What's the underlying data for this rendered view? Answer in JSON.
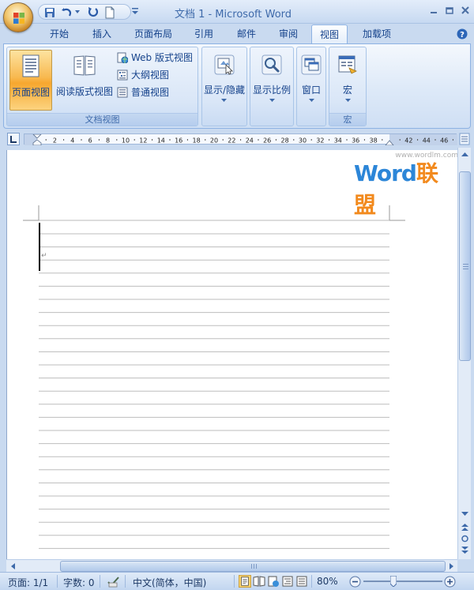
{
  "window": {
    "title": "文档 1 - Microsoft Word"
  },
  "qat": {
    "icons": [
      "save-icon",
      "undo-icon",
      "redo-icon",
      "new-document-icon",
      "customize-qat-icon"
    ]
  },
  "tabs": [
    {
      "label": "开始"
    },
    {
      "label": "插入"
    },
    {
      "label": "页面布局"
    },
    {
      "label": "引用"
    },
    {
      "label": "邮件"
    },
    {
      "label": "审阅"
    },
    {
      "label": "视图",
      "active": true
    },
    {
      "label": "加载项"
    }
  ],
  "ribbon": {
    "doc_views": {
      "group_label": "文档视图",
      "print_layout": "页面视图",
      "full_screen_reading": "阅读版式视图",
      "web_layout": "Web 版式视图",
      "outline": "大纲视图",
      "draft": "普通视图"
    },
    "show_hide": {
      "label": "显示/隐藏"
    },
    "zoom": {
      "label": "显示比例"
    },
    "window": {
      "label": "窗口"
    },
    "macros": {
      "label": "宏",
      "group_label": "宏"
    }
  },
  "ruler": {
    "ticks": [
      "2",
      "4",
      "6",
      "8",
      "10",
      "12",
      "14",
      "16",
      "18",
      "20",
      "22",
      "24",
      "26",
      "28",
      "30",
      "32",
      "34",
      "36",
      "38",
      "42",
      "44",
      "46"
    ]
  },
  "watermark": {
    "url": "www.wordlm.com",
    "word": "Word",
    "suffix": "联盟"
  },
  "statusbar": {
    "page": "页面: 1/1",
    "words": "字数: 0",
    "language": "中文(简体，中国)",
    "zoom": "80%"
  },
  "colors": {
    "accent": "#15428b",
    "watermark_blue": "#2c86d8",
    "watermark_orange": "#f28a1e"
  }
}
